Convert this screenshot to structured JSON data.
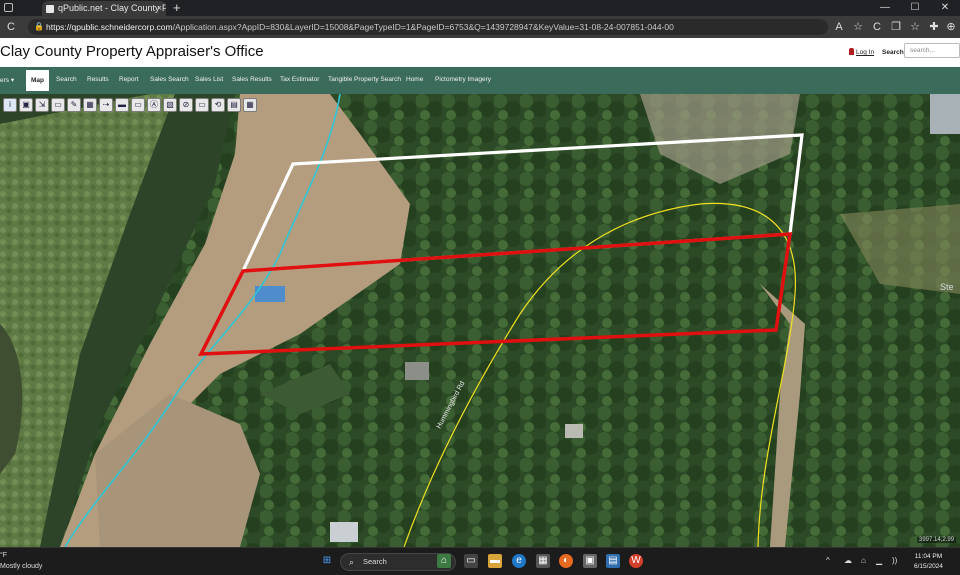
{
  "browser": {
    "tab_title": "qPublic.net - Clay County Proper",
    "tab_close": "×",
    "new_tab": "+",
    "window_controls": {
      "minimize": "—",
      "maximize": "☐",
      "close": "✕"
    },
    "nav": {
      "back": "←",
      "reload": "C"
    },
    "url_host": "https://qpublic.schneidercorp.com",
    "url_path": "/Application.aspx?AppID=830&LayerID=15008&PageTypeID=1&PageID=6753&Q=1439728947&KeyValue=31-08-24-007851-044-00",
    "toolbar_icons": [
      "⇩",
      "A",
      "☆",
      "C",
      "❐",
      "☆",
      "✚",
      "☐",
      "⊕"
    ]
  },
  "header": {
    "title": "Clay County Property Appraiser's Office",
    "login_label": "Log In",
    "search_label": "Search",
    "search_placeholder": "search..."
  },
  "menu": {
    "partial_first": "ers",
    "active": "Map",
    "items": [
      "Search",
      "Results",
      "Report",
      "Sales Search",
      "Sales List",
      "Sales Results",
      "Tax Estimator",
      "Tangible Property Search",
      "Home",
      "Pictometry Imagery"
    ]
  },
  "map": {
    "tools": [
      "i",
      "▣",
      "⇲",
      "▭",
      "✎",
      "▦",
      "⇢",
      "▬",
      "▭",
      "Ⓐ",
      "▧",
      "⊘",
      "▭",
      "⟲",
      "▤",
      "▦"
    ],
    "road_label": "Hummingbird Rd",
    "partial_label": "Ste",
    "scale_label": "3997.14,2.99",
    "colors": {
      "selected_parcel": "#e01010",
      "adjacent_parcel": "#ffffff",
      "road_line": "#f0e020",
      "water_line": "#2fc6d6"
    }
  },
  "taskbar": {
    "weather_temp": "°F",
    "weather_text": "Mostly cloudy",
    "search_label": "Search",
    "time": "11:04 PM",
    "date": "6/15/2024",
    "tray": [
      "^",
      "☁",
      "⌂",
      "▁",
      "))"
    ]
  }
}
